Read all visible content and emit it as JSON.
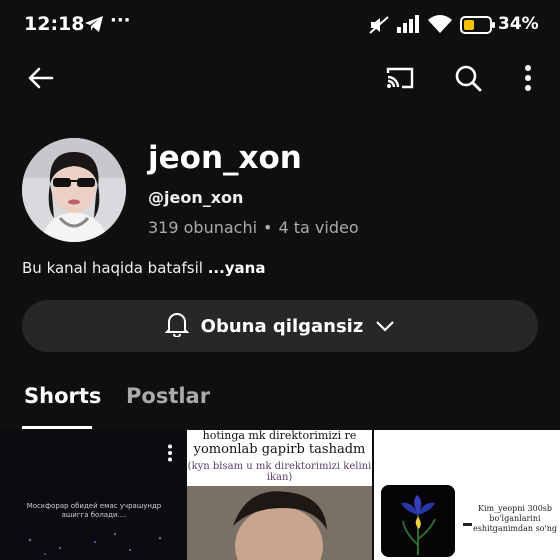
{
  "status_bar": {
    "time": "12:18",
    "more_indicator": "···",
    "battery_percent": "34%",
    "icons": [
      "telegram-icon",
      "more-dots-icon",
      "mute-icon",
      "signal-icon",
      "wifi-icon",
      "battery-icon"
    ]
  },
  "app_bar": {
    "icons": [
      "back-arrow-icon",
      "cast-icon",
      "search-icon",
      "more-vert-icon"
    ]
  },
  "channel": {
    "name": "jeon_xon",
    "handle": "@jeon_xon",
    "subscribers": "319 obunachi",
    "separator": "•",
    "videos": "4 ta video",
    "about": "Bu kanal haqida batafsil",
    "about_more": "...yana"
  },
  "subscribe_button": {
    "label": "Obuna qilgansiz",
    "icon": "bell-icon",
    "chevron": "chevron-down-icon"
  },
  "tabs": [
    {
      "label": "Shorts",
      "active": true
    },
    {
      "label": "Postlar",
      "active": false
    }
  ],
  "shorts": [
    {
      "caption": "Москфорар обидей емас учрашундр ашигга болади....",
      "overlay_icon": "more-vert-icon"
    },
    {
      "line1": "hotinga mk direktorimizi re",
      "line2": "yomonlab gapirb tashadm",
      "sub": "(kyn blsam u mk direktorimizi kelini ikan)"
    },
    {
      "caption": "Kim_yeopni 300sb bo'lganlarini eshitganimdan so'ng",
      "dash": "-"
    }
  ],
  "colors": {
    "background": "#0f0f0f",
    "button_bg": "#272727",
    "secondary_text": "#aaaaaa",
    "primary_text": "#f1f1f1"
  }
}
